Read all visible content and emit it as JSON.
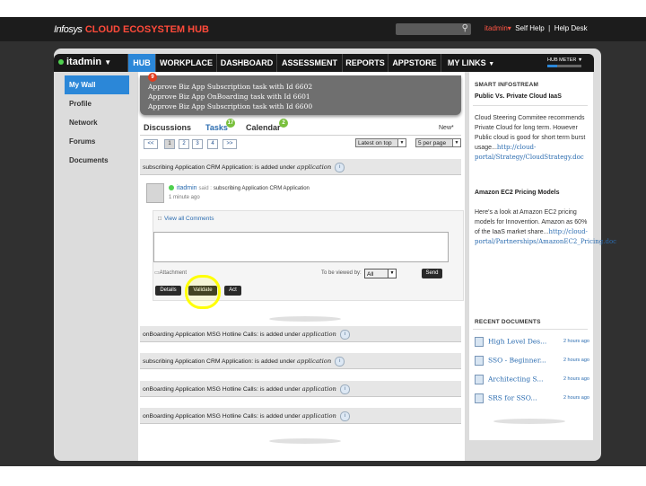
{
  "header": {
    "brand_prefix": "Infosys",
    "brand_name": "CLOUD ECOSYSTEM HUB",
    "search_icon": "search-icon",
    "user_link": "itadmin",
    "self_help": "Self Help",
    "help_desk": "Help Desk"
  },
  "nav": {
    "user": "itadmin",
    "tabs": [
      {
        "label": "HUB"
      },
      {
        "label": "WORKPLACE"
      },
      {
        "label": "DASHBOARD"
      },
      {
        "label": "ASSESSMENT"
      },
      {
        "label": "REPORTS"
      },
      {
        "label": "APPSTORE"
      },
      {
        "label": "MY LINKS"
      }
    ],
    "hub_meter_label": "HUB METER",
    "hub_meter_level": 0.3
  },
  "sidebar": {
    "items": [
      {
        "label": "My Wall",
        "active": true
      },
      {
        "label": "Profile"
      },
      {
        "label": "Network"
      },
      {
        "label": "Forums"
      },
      {
        "label": "Documents"
      }
    ]
  },
  "tasks_dropdown": {
    "badge": "9",
    "items": [
      "Approve Biz App Subscription task with Id 6602",
      "Approve Biz App OnBoarding task with Id 6601",
      "Approve Biz App Subscription task with Id 6600"
    ]
  },
  "subtabs": {
    "discussions": "Discussions",
    "tasks": "Tasks",
    "tasks_count": "17",
    "calendar": "Calendar",
    "calendar_count": "2",
    "new_link": "New*"
  },
  "pager": {
    "prev": "<<",
    "pages": [
      "1",
      "2",
      "3",
      "4"
    ],
    "next": ">>",
    "sort": "Latest on top",
    "per_page": "5 per page"
  },
  "feed": {
    "first": "subscribing Application CRM Application: is added under",
    "rows": [
      "onBoarding Application MSG Hotline Calls: is added under",
      "subscribing Application CRM Application: is added under",
      "onBoarding Application MSG Hotline Calls: is added under",
      "onBoarding Application MSG Hotline Calls: is added under"
    ],
    "app_word": "application"
  },
  "post": {
    "author": "itadmin",
    "said": "said :",
    "text": "subscribing Application CRM Application",
    "time": "1 minute ago",
    "view_all": "View all Comments",
    "attachment": "Attachment",
    "to_be_viewed": "To be viewed by:",
    "visibility": "All",
    "send": "Send",
    "details": "Details",
    "validate": "Validate",
    "act": "Act"
  },
  "right": {
    "smart_infostream": "SMART INFOSTREAM",
    "article1_title": "Public Vs. Private Cloud IaaS",
    "article1_text": "Cloud Steering Commitee recommends Private Cloud for long term. However Public cloud is good for short term burst usage...",
    "article1_link": "http://cloud-portal/Strategy/CloudStrategy.doc",
    "article2_title": "Amazon EC2 Pricing Models",
    "article2_text": "Here's a look at Amazon EC2 pricing models for Innovention. Amazon as 60% of the IaaS market share...",
    "article2_link": "http://cloud-portal/Partnerships/AmazonEC2_Pricing.doc",
    "recent_docs": "RECENT DOCUMENTS",
    "docs": [
      {
        "name": "High Level Des...",
        "ago": "2 hours ago"
      },
      {
        "name": "SSO - Beginner...",
        "ago": "2 hours ago"
      },
      {
        "name": "Architecting S...",
        "ago": "2 hours ago"
      },
      {
        "name": "SRS for SSO...",
        "ago": "2 hours ago"
      }
    ]
  }
}
